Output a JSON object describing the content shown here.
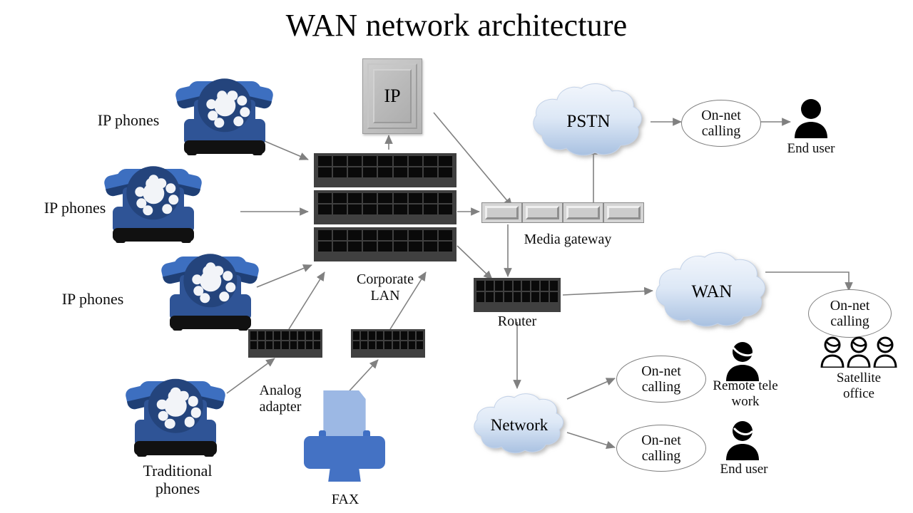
{
  "title": "WAN network architecture",
  "labels": {
    "ip_phones_1": "IP phones",
    "ip_phones_2": "IP phones",
    "ip_phones_3": "IP phones",
    "traditional_phones": "Traditional\nphones",
    "analog_adapter": "Analog\nadapter",
    "fax": "FAX",
    "corporate_lan": "Corporate\nLAN",
    "ip_pbx": "IP",
    "media_gateway": "Media gateway",
    "router": "Router",
    "pstn": "PSTN",
    "wan": "WAN",
    "network": "Network",
    "on_net_calling_pstn": "On-net\ncalling",
    "on_net_calling_wan": "On-net\ncalling",
    "on_net_calling_remote": "On-net\ncalling",
    "on_net_calling_end": "On-net\ncalling",
    "end_user_top": "End user",
    "end_user_bottom": "End user",
    "remote_tele_work": "Remote tele\nwork",
    "satellite_office": "Satellite\noffice"
  },
  "colors": {
    "phone_handset": "#3d6fc0",
    "phone_body": "#2f5496",
    "phone_base": "#111111",
    "switch_body": "#404040",
    "switch_port": "#0a0a0a",
    "cloud_top": "#edf2fa",
    "cloud_bottom": "#a8c0e0",
    "cloud_stroke": "#c3d2e8",
    "fax_body": "#4472c4",
    "fax_paper": "#9cb8e4",
    "gateway_face": "#cccccc",
    "arrow": "#808080",
    "text": "#0d0d0d",
    "background": "#ffffff"
  },
  "icons": {
    "phone": "telephone-icon",
    "switch": "network-switch-icon",
    "router": "router-icon",
    "gateway": "media-gateway-icon",
    "cloud": "cloud-icon",
    "person": "person-icon",
    "people": "people-group-icon",
    "fax": "fax-machine-icon",
    "pbx": "ip-pbx-icon"
  }
}
